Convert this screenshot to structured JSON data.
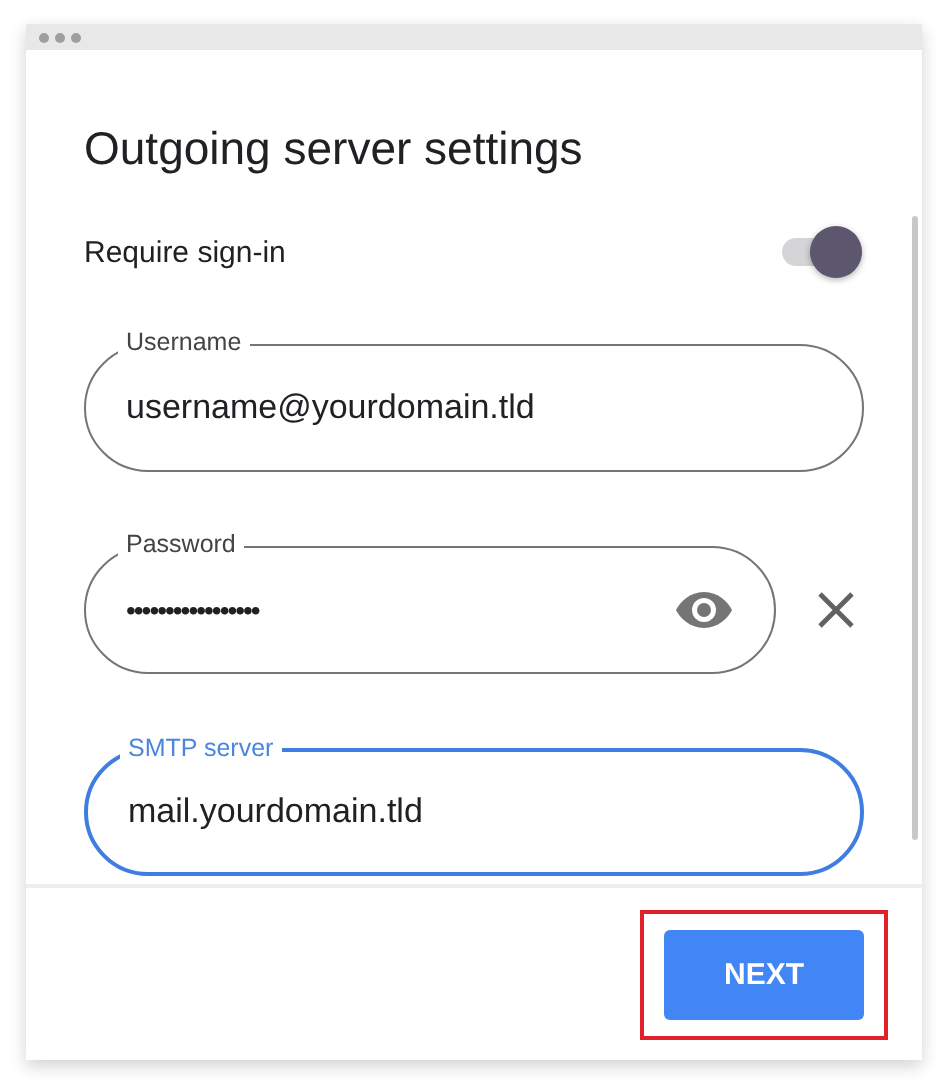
{
  "title": "Outgoing server settings",
  "toggle": {
    "label": "Require sign-in",
    "on": true
  },
  "fields": [
    {
      "kind": "text",
      "label": "Username",
      "value": "username@yourdomain.tld",
      "focused": false
    },
    {
      "kind": "password",
      "label": "Password",
      "value": "•••••••••••••••••",
      "focused": false
    },
    {
      "kind": "text",
      "label": "SMTP server",
      "value": "mail.yourdomain.tld",
      "focused": true
    }
  ],
  "button": {
    "label": "NEXT",
    "highlighted": true
  }
}
